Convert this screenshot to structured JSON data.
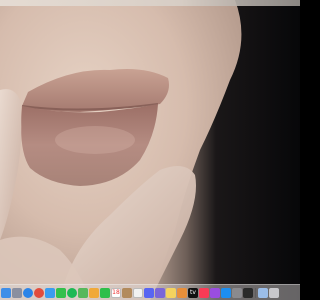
{
  "desktop": {
    "wallpaper": {
      "icon": "photo-wallpaper",
      "colors": {
        "skin": "#d9c2b3",
        "lips": "#b88e84",
        "background_dark": "#0b0b0d"
      }
    }
  },
  "menu_bar": {
    "color": "#e2dad2"
  },
  "dock": {
    "background": "#d7d3d3",
    "apps": [
      {
        "icon": "finder-icon",
        "color": "#3f8ee8",
        "glyph": ""
      },
      {
        "icon": "launchpad-icon",
        "color": "#8a8fa0",
        "glyph": ""
      },
      {
        "icon": "safari-icon",
        "color": "#2b84e8",
        "glyph": ""
      },
      {
        "icon": "chrome-icon",
        "color": "#e24c3c",
        "glyph": ""
      },
      {
        "icon": "mail-icon",
        "color": "#3b9cf0",
        "glyph": ""
      },
      {
        "icon": "messages-icon",
        "color": "#33c04c",
        "glyph": ""
      },
      {
        "icon": "spotify-icon",
        "color": "#1db954",
        "glyph": ""
      },
      {
        "icon": "maps-icon",
        "color": "#56b85b",
        "glyph": ""
      },
      {
        "icon": "photos-icon",
        "color": "#f0a93a",
        "glyph": ""
      },
      {
        "icon": "facetime-icon",
        "color": "#2fbf4a",
        "glyph": ""
      },
      {
        "icon": "calendar-icon",
        "color": "#ffffff",
        "glyph": "18"
      },
      {
        "icon": "contacts-icon",
        "color": "#b28a5c",
        "glyph": ""
      },
      {
        "icon": "reminders-icon",
        "color": "#f2f2f2",
        "glyph": ""
      },
      {
        "icon": "discord-icon",
        "color": "#5865f2",
        "glyph": ""
      },
      {
        "icon": "finder-alt-icon",
        "color": "#7a66d8",
        "glyph": ""
      },
      {
        "icon": "notes-icon",
        "color": "#f4d35e",
        "glyph": ""
      },
      {
        "icon": "preview-icon",
        "color": "#e88f3a",
        "glyph": ""
      },
      {
        "icon": "appletv-icon",
        "color": "#111111",
        "glyph": "tv"
      },
      {
        "icon": "music-icon",
        "color": "#fa3b55",
        "glyph": ""
      },
      {
        "icon": "podcasts-icon",
        "color": "#9a4de0",
        "glyph": ""
      },
      {
        "icon": "appstore-icon",
        "color": "#1c8ef0",
        "glyph": ""
      },
      {
        "icon": "settings-icon",
        "color": "#8a8a8e",
        "glyph": ""
      },
      {
        "icon": "terminal-icon",
        "color": "#2a2a2a",
        "glyph": ""
      }
    ],
    "trailing": [
      {
        "icon": "downloads-icon",
        "color": "#9bbde8",
        "glyph": ""
      },
      {
        "icon": "trash-icon",
        "color": "#c8c8cc",
        "glyph": ""
      }
    ]
  }
}
